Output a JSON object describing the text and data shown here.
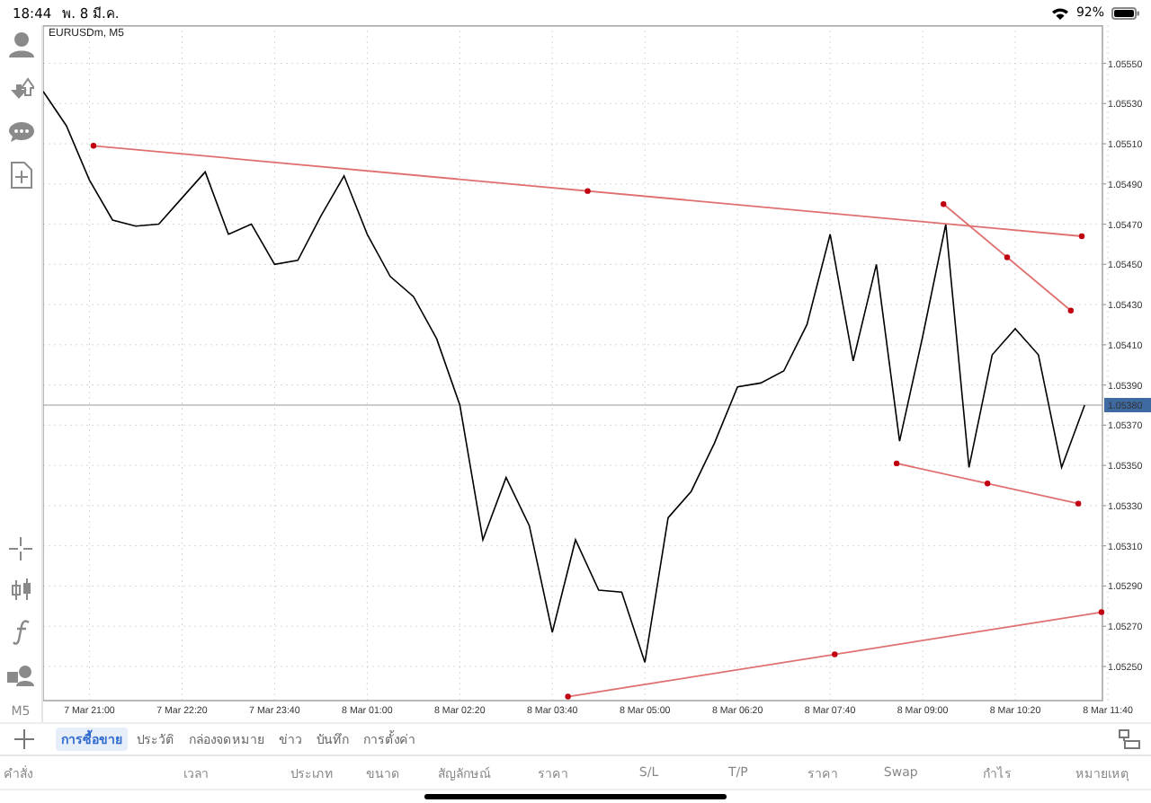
{
  "status_bar": {
    "time": "18:44",
    "date": "พ. 8 มี.ค.",
    "battery": "92%"
  },
  "chart": {
    "chart_data": {
      "type": "line",
      "title": "EURUSDm, M5",
      "categories": [
        null,
        null,
        "7 Mar 21:00",
        null,
        null,
        null,
        "7 Mar 22:20",
        null,
        null,
        null,
        "7 Mar 23:40",
        null,
        null,
        null,
        "8 Mar 01:00",
        null,
        null,
        null,
        "8 Mar 02:20",
        null,
        null,
        null,
        "8 Mar 03:40",
        null,
        null,
        null,
        "8 Mar 05:00",
        null,
        null,
        null,
        "8 Mar 06:20",
        null,
        null,
        null,
        "8 Mar 07:40",
        null,
        null,
        null,
        "8 Mar 09:00",
        null,
        null,
        null,
        "8 Mar 10:20",
        null,
        null,
        null,
        "8 Mar 11:40"
      ],
      "series": [
        {
          "color": "#000000",
          "values": [
            1.05536,
            1.05519,
            1.05492,
            1.05472,
            1.05469,
            1.0547,
            1.05483,
            1.05496,
            1.05465,
            1.0547,
            1.0545,
            1.05452,
            1.05474,
            1.05494,
            1.05465,
            1.05444,
            1.05434,
            1.05413,
            1.0538,
            1.05313,
            1.05344,
            1.0532,
            1.05267,
            1.05313,
            1.05288,
            1.05287,
            1.05252,
            1.05324,
            1.05337,
            1.05361,
            1.05389,
            1.05391,
            1.05397,
            1.0542,
            1.05465,
            1.05402,
            1.0545,
            1.05362,
            1.05414,
            1.0547,
            1.05349,
            1.05405,
            1.05418,
            1.05405,
            1.05349,
            1.0538,
            null
          ]
        }
      ],
      "ylim": [
        1.05233,
        1.05569
      ],
      "grid": true,
      "yticks": [
        {
          "value": 1.0555,
          "label": "1.05550"
        },
        {
          "value": 1.0553,
          "label": "1.05530"
        },
        {
          "value": 1.0551,
          "label": "1.05510"
        },
        {
          "value": 1.0549,
          "label": "1.05490"
        },
        {
          "value": 1.0547,
          "label": "1.05470"
        },
        {
          "value": 1.0545,
          "label": "1.05450"
        },
        {
          "value": 1.0543,
          "label": "1.05430"
        },
        {
          "value": 1.0541,
          "label": "1.05410"
        },
        {
          "value": 1.0539,
          "label": "1.05390"
        },
        {
          "value": 1.0537,
          "label": "1.05370"
        },
        {
          "value": 1.0535,
          "label": "1.05350"
        },
        {
          "value": 1.0533,
          "label": "1.05330"
        },
        {
          "value": 1.0531,
          "label": "1.05310"
        },
        {
          "value": 1.0529,
          "label": "1.05290"
        },
        {
          "value": 1.0527,
          "label": "1.05270"
        },
        {
          "value": 1.0525,
          "label": "1.05250"
        }
      ],
      "ref_lines": [
        {
          "axis": "y",
          "value": 1.0538,
          "label": "1.05380"
        }
      ]
    }
  },
  "toolbar": {
    "timeframe": "M5"
  },
  "tabs": [
    {
      "label": "การซื้อขาย",
      "selected": true
    },
    {
      "label": "ประวัติ",
      "selected": false
    },
    {
      "label": "กล่องจดหมาย",
      "selected": false
    },
    {
      "label": "ข่าว",
      "selected": false
    },
    {
      "label": "บันทึก",
      "selected": false
    },
    {
      "label": "การตั้งค่า",
      "selected": false
    }
  ],
  "table": {
    "columns": [
      "คำสั่ง",
      "เวลา",
      "ประเภท",
      "ขนาด",
      "สัญลักษณ์",
      "ราคา",
      "S/L",
      "T/P",
      "ราคา",
      "Swap",
      "กำไร",
      "หมายเหตุ"
    ]
  }
}
